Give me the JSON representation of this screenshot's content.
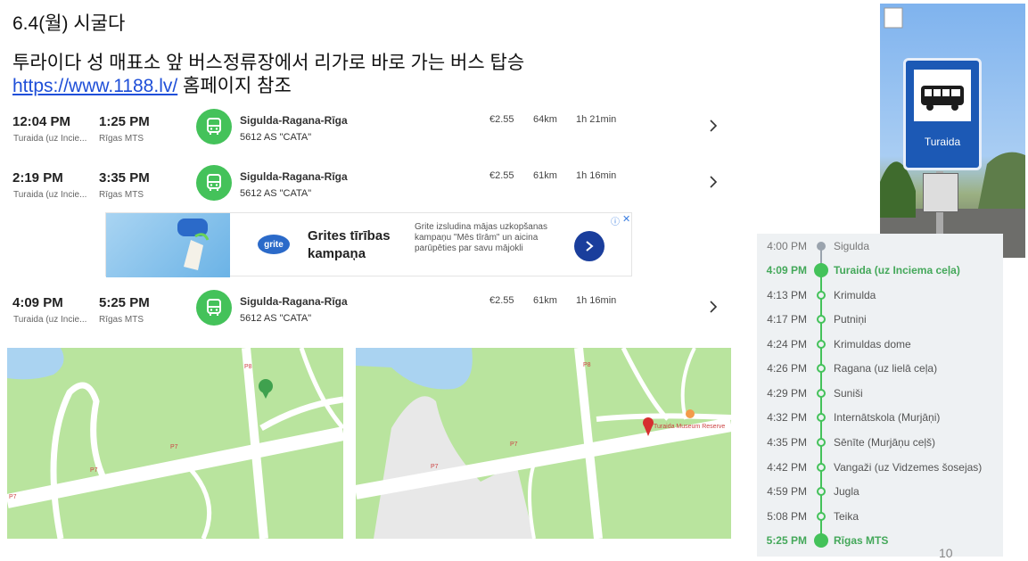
{
  "header": {
    "date_title": "6.4(월) 시굴다",
    "subtitle": "투라이다 성 매표소 앞 버스정류장에서 리가로 바로 가는 버스 탑승",
    "link_text": "https://www.1188.lv/",
    "link_suffix": " 홈페이지 참조"
  },
  "trips": [
    {
      "dep_time": "12:04 PM",
      "dep_stop": "Turaida (uz Incie...",
      "arr_time": "1:25 PM",
      "arr_stop": "Rīgas MTS",
      "route": "Sigulda-Ragana-Rīga",
      "operator": "5612  AS \"CATA\"",
      "price": "€2.55",
      "distance": "64km",
      "duration": "1h 21min"
    },
    {
      "dep_time": "2:19 PM",
      "dep_stop": "Turaida (uz Incie...",
      "arr_time": "3:35 PM",
      "arr_stop": "Rīgas MTS",
      "route": "Sigulda-Ragana-Rīga",
      "operator": "5612  AS \"CATA\"",
      "price": "€2.55",
      "distance": "61km",
      "duration": "1h 16min"
    },
    {
      "dep_time": "4:09 PM",
      "dep_stop": "Turaida (uz Incie...",
      "arr_time": "5:25 PM",
      "arr_stop": "Rīgas MTS",
      "route": "Sigulda-Ragana-Rīga",
      "operator": "5612  AS \"CATA\"",
      "price": "€2.55",
      "distance": "61km",
      "duration": "1h 16min"
    }
  ],
  "ad": {
    "logo": "grite",
    "title": "Grites tīrības kampaņa",
    "text": "Grite izsludina mājas uzkopšanas kampaņu \"Mēs tīrām\" un aicina parūpēties par savu mājokli",
    "info": "ⓘ",
    "close": "✕"
  },
  "maps": {
    "road_labels": [
      "P8",
      "P7",
      "P7",
      "P7"
    ],
    "road_labels_right": [
      "P8",
      "P7",
      "P7"
    ],
    "poi_name": "Turaida Museum Reserve"
  },
  "photo": {
    "sign_text": "Turaida"
  },
  "stops": [
    {
      "time": "4:00 PM",
      "name": "Sigulda"
    },
    {
      "time": "4:09 PM",
      "name": "Turaida (uz Inciema ceļa)"
    },
    {
      "time": "4:13 PM",
      "name": "Krimulda"
    },
    {
      "time": "4:17 PM",
      "name": "Putniņi"
    },
    {
      "time": "4:24 PM",
      "name": "Krimuldas dome"
    },
    {
      "time": "4:26 PM",
      "name": "Ragana (uz lielā ceļa)"
    },
    {
      "time": "4:29 PM",
      "name": "Suniši"
    },
    {
      "time": "4:32 PM",
      "name": "Internātskola (Murjāņi)"
    },
    {
      "time": "4:35 PM",
      "name": "Sēnīte (Murjāņu ceļš)"
    },
    {
      "time": "4:42 PM",
      "name": "Vangaži (uz Vidzemes šosejas)"
    },
    {
      "time": "4:59 PM",
      "name": "Jugla"
    },
    {
      "time": "5:08 PM",
      "name": "Teika"
    },
    {
      "time": "5:25 PM",
      "name": "Rīgas MTS"
    }
  ],
  "page_number": "10",
  "colors": {
    "accent_green": "#44c25a",
    "link_blue": "#1f4fd8",
    "map_green": "#b9e49e",
    "water_blue": "#aad3f1"
  }
}
